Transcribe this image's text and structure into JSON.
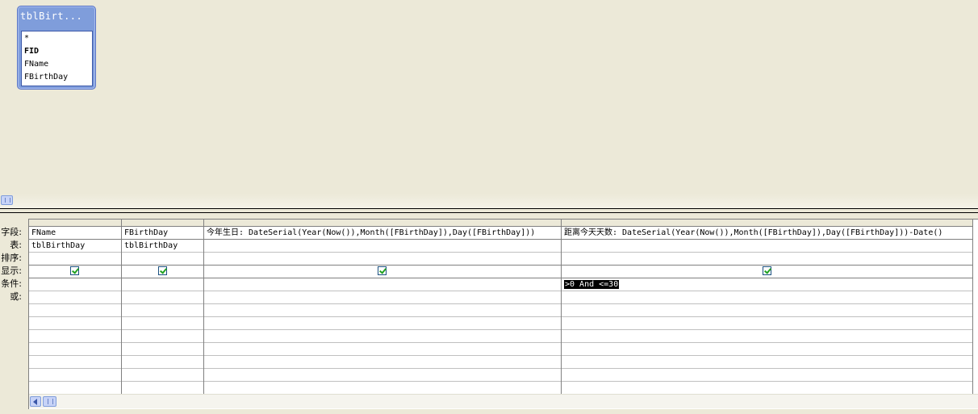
{
  "table": {
    "title": "tblBirt...",
    "fields": [
      "*",
      "FID",
      "FName",
      "FBirthDay"
    ]
  },
  "row_labels": [
    "字段:",
    "表:",
    "排序:",
    "显示:",
    "条件:",
    "或:"
  ],
  "columns": [
    {
      "field": "FName",
      "table": "tblBirthDay",
      "sort": "",
      "show": true,
      "criteria": "",
      "or": ""
    },
    {
      "field": "FBirthDay",
      "table": "tblBirthDay",
      "sort": "",
      "show": true,
      "criteria": "",
      "or": ""
    },
    {
      "field": "今年生日: DateSerial(Year(Now()),Month([FBirthDay]),Day([FBirthDay]))",
      "table": "",
      "sort": "",
      "show": true,
      "criteria": "",
      "or": ""
    },
    {
      "field": "距离今天天数: DateSerial(Year(Now()),Month([FBirthDay]),Day([FBirthDay]))-Date()",
      "table": "",
      "sort": "",
      "show": true,
      "criteria": ">0 And <=30",
      "or": ""
    }
  ],
  "icons": {
    "scroll_left": "arrow-left-icon",
    "scroll_thumb": "grip-icon",
    "checkbox": "checkmark-icon"
  },
  "colors": {
    "table_header": "#7f9ddb",
    "check": "#21a121",
    "background": "#ece9d8"
  }
}
